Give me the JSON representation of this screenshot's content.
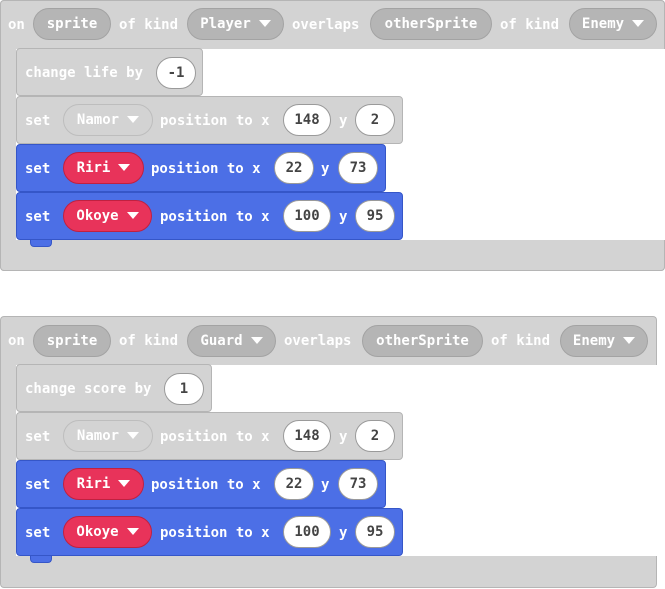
{
  "events": [
    {
      "on": "on",
      "sprite": "sprite",
      "of_kind": "of kind",
      "kind1": "Player",
      "overlaps": "overlaps",
      "other": "otherSprite",
      "of_kind2": "of kind",
      "kind2": "Enemy",
      "change": {
        "label": "change life by",
        "value": "-1"
      },
      "set_rows": [
        {
          "set": "set",
          "sprite": "Namor",
          "pos": "position to x",
          "x": "148",
          "y_label": "y",
          "y": "2",
          "style": "gray"
        },
        {
          "set": "set",
          "sprite": "Riri",
          "pos": "position to x",
          "x": "22",
          "y_label": "y",
          "y": "73",
          "style": "blue"
        },
        {
          "set": "set",
          "sprite": "Okoye",
          "pos": "position to x",
          "x": "100",
          "y_label": "y",
          "y": "95",
          "style": "blue"
        }
      ]
    },
    {
      "on": "on",
      "sprite": "sprite",
      "of_kind": "of kind",
      "kind1": "Guard",
      "overlaps": "overlaps",
      "other": "otherSprite",
      "of_kind2": "of kind",
      "kind2": "Enemy",
      "change": {
        "label": "change score by",
        "value": "1"
      },
      "set_rows": [
        {
          "set": "set",
          "sprite": "Namor",
          "pos": "position to x",
          "x": "148",
          "y_label": "y",
          "y": "2",
          "style": "gray"
        },
        {
          "set": "set",
          "sprite": "Riri",
          "pos": "position to x",
          "x": "22",
          "y_label": "y",
          "y": "73",
          "style": "blue"
        },
        {
          "set": "set",
          "sprite": "Okoye",
          "pos": "position to x",
          "x": "100",
          "y_label": "y",
          "y": "95",
          "style": "blue"
        }
      ]
    }
  ],
  "colors": {
    "gray_block": "#d3d3d3",
    "blue_block": "#4c6fe6",
    "red_sprite": "#e8335a",
    "number_pill": "#ffffff"
  },
  "icons": {
    "dropdown": "chevron-down-icon"
  }
}
